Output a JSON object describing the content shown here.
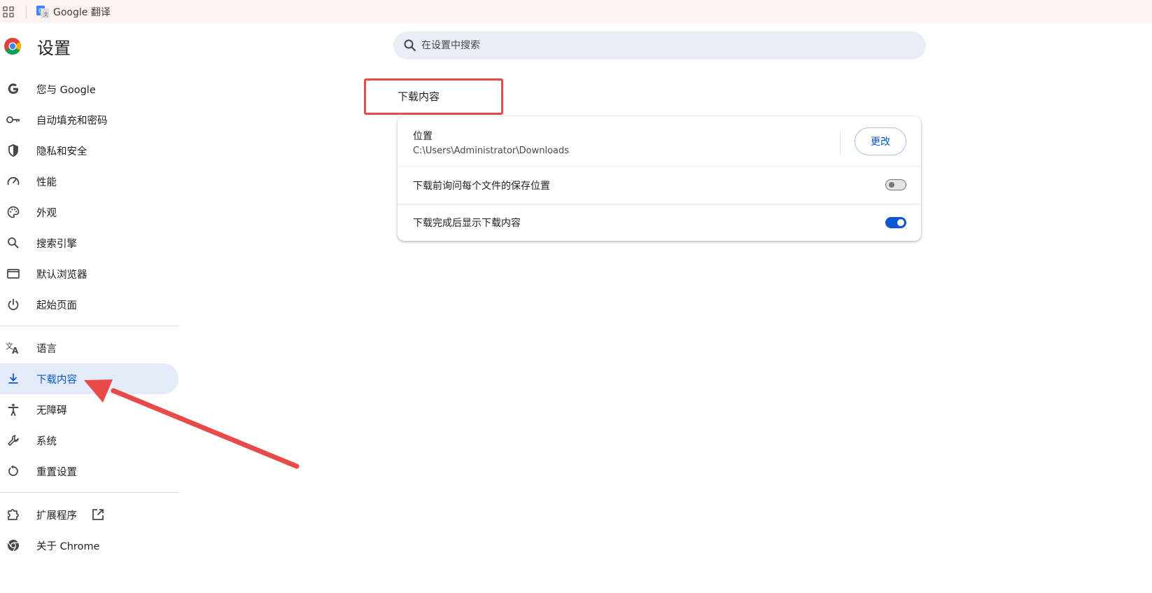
{
  "bookmarks_bar": {
    "items": [
      {
        "label": "Google 翻译",
        "icon": "google-translate-icon"
      }
    ]
  },
  "header": {
    "title": "设置",
    "search_placeholder": "在设置中搜索"
  },
  "sidebar": {
    "items": [
      {
        "label": "您与 Google",
        "icon": "google-g-icon"
      },
      {
        "label": "自动填充和密码",
        "icon": "key-icon"
      },
      {
        "label": "隐私和安全",
        "icon": "shield-icon"
      },
      {
        "label": "性能",
        "icon": "speedometer-icon"
      },
      {
        "label": "外观",
        "icon": "palette-icon"
      },
      {
        "label": "搜索引擎",
        "icon": "search-icon"
      },
      {
        "label": "默认浏览器",
        "icon": "browser-window-icon"
      },
      {
        "label": "起始页面",
        "icon": "power-icon"
      },
      {
        "label": "语言",
        "icon": "translate-icon"
      },
      {
        "label": "下载内容",
        "icon": "download-icon",
        "active": true
      },
      {
        "label": "无障碍",
        "icon": "accessibility-icon"
      },
      {
        "label": "系统",
        "icon": "wrench-icon"
      },
      {
        "label": "重置设置",
        "icon": "reset-icon"
      },
      {
        "label": "扩展程序",
        "icon": "puzzle-icon"
      },
      {
        "label": "关于 Chrome",
        "icon": "chrome-icon"
      }
    ]
  },
  "downloads": {
    "section_title": "下载内容",
    "location_label": "位置",
    "location_path": "C:\\Users\\Administrator\\Downloads",
    "change_button": "更改",
    "ask_where_label": "下载前询问每个文件的保存位置",
    "ask_where_enabled": false,
    "show_downloads_label": "下载完成后显示下载内容",
    "show_downloads_enabled": true
  },
  "colors": {
    "accent": "#0b57d0",
    "active_nav_bg": "#e3eaf8",
    "annotation_red": "#e84a4a"
  }
}
